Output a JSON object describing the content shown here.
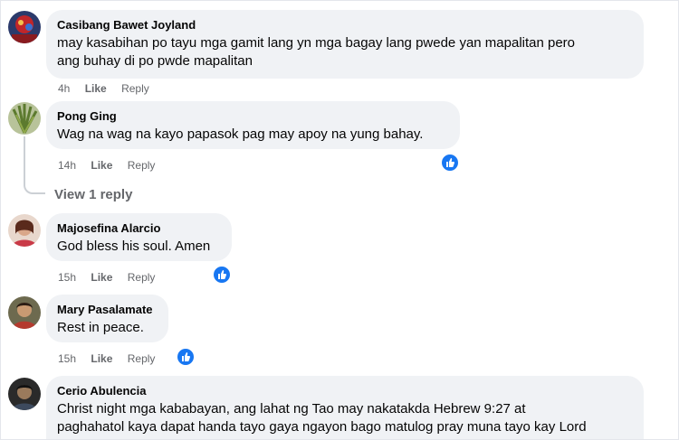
{
  "comments": [
    {
      "author": "Casibang Bawet Joyland",
      "text_line1": "may kasabihan po tayu mga gamit lang yn mga bagay lang pwede yan mapalitan pero",
      "text_line2": "ang buhay di po pwde mapalitan",
      "time": "4h",
      "like": "Like",
      "reply": "Reply"
    },
    {
      "author": "Pong Ging",
      "text_line1": "Wag na wag na kayo papasok pag may apoy na yung bahay.",
      "time": "14h",
      "like": "Like",
      "reply": "Reply",
      "reaction": "like"
    },
    {
      "author": "Majosefina Alarcio",
      "text_line1": "God bless his soul. Amen",
      "time": "15h",
      "like": "Like",
      "reply": "Reply",
      "reaction": "like"
    },
    {
      "author": "Mary Pasalamate",
      "text_line1": "Rest in peace.",
      "time": "15h",
      "like": "Like",
      "reply": "Reply",
      "reaction": "like"
    },
    {
      "author": "Cerio Abulencia",
      "text_line1": "Christ night mga kababayan, ang lahat ng Tao may nakatakda Hebrew 9:27 at",
      "text_line2": "paghahatol kaya dapat handa tayo gaya ngayon bago matulog pray muna tayo kay Lord"
    }
  ],
  "view_replies": "View 1 reply",
  "colors": {
    "like_blue": "#1877f2",
    "bubble": "#f0f2f5",
    "meta": "#65676b"
  },
  "icons": {
    "reaction": "thumbs-up-icon"
  }
}
